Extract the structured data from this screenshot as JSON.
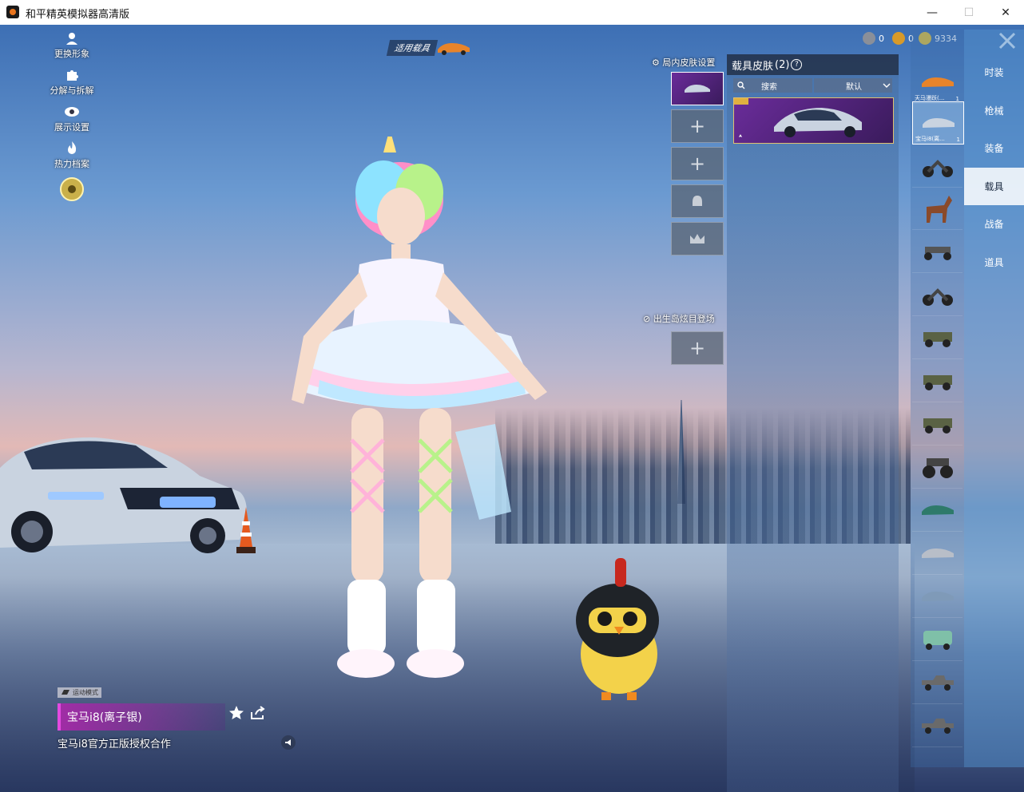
{
  "window": {
    "title": "和平精英模拟器高清版",
    "controls": {
      "minimize": "—",
      "maximize": "☐",
      "close": "✕"
    }
  },
  "left_menu": [
    {
      "label": "更换形象",
      "icon": "avatar-icon"
    },
    {
      "label": "分解与拆解",
      "icon": "puzzle-icon"
    },
    {
      "label": "展示设置",
      "icon": "eye-icon"
    },
    {
      "label": "热力档案",
      "icon": "flame-icon"
    }
  ],
  "vehicle_tag": {
    "label": "适用载具"
  },
  "currencies": [
    {
      "value": "0",
      "color": "#8a8f99"
    },
    {
      "value": "0",
      "color": "#d89a2a"
    },
    {
      "value": "9334",
      "color": "#e8c53a"
    }
  ],
  "skin_settings": {
    "label": "局内皮肤设置"
  },
  "birth_island": {
    "label": "出生岛炫目登场"
  },
  "skin_panel": {
    "title": "载具皮肤",
    "count": "(2)",
    "help": "?",
    "search_label": "搜索",
    "sort_label": "默认"
  },
  "right_tabs": [
    "时装",
    "枪械",
    "装备",
    "载具",
    "战备",
    "道具"
  ],
  "active_tab_index": 3,
  "thumbs": [
    {
      "name": "天马漫跃(...",
      "count": "1",
      "kind": "car-orange"
    },
    {
      "name": "宝马i8(离...",
      "count": "1",
      "kind": "car-silver"
    },
    {
      "name": "",
      "count": "",
      "kind": "motorcycle"
    },
    {
      "name": "",
      "count": "",
      "kind": "horse"
    },
    {
      "name": "",
      "count": "",
      "kind": "buggy"
    },
    {
      "name": "",
      "count": "",
      "kind": "motorcycle"
    },
    {
      "name": "",
      "count": "",
      "kind": "jeep"
    },
    {
      "name": "",
      "count": "",
      "kind": "jeep"
    },
    {
      "name": "",
      "count": "",
      "kind": "jeep"
    },
    {
      "name": "",
      "count": "",
      "kind": "monster-truck"
    },
    {
      "name": "",
      "count": "",
      "kind": "sedan-green"
    },
    {
      "name": "",
      "count": "",
      "kind": "sedan-silver"
    },
    {
      "name": "",
      "count": "",
      "kind": "sedan-blue"
    },
    {
      "name": "",
      "count": "",
      "kind": "van"
    },
    {
      "name": "",
      "count": "",
      "kind": "pickup"
    },
    {
      "name": "",
      "count": "",
      "kind": "pickup"
    }
  ],
  "vehicle_info": {
    "mode": "运动模式",
    "name": "宝马i8(离子银)",
    "subtitle": "宝马i8官方正版授权合作"
  },
  "colors": {
    "accent": "#e34ae0",
    "panel": "#3a1b5c",
    "tab_active": "#ffffff"
  }
}
